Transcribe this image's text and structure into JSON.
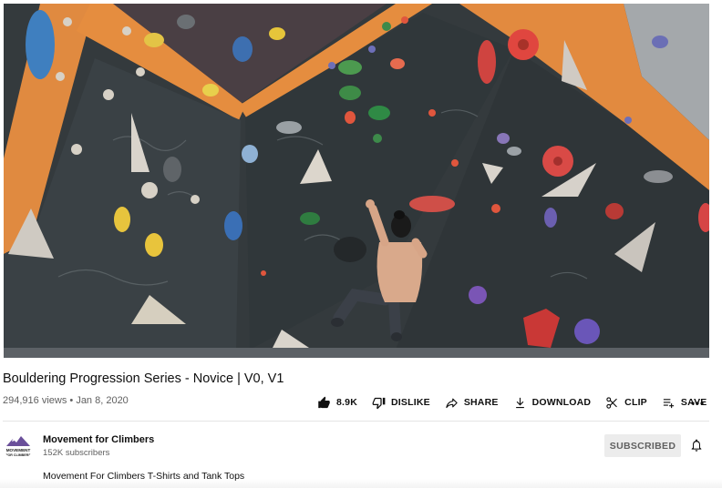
{
  "video": {
    "title": "Bouldering Progression Series - Novice | V0, V1",
    "views": "294,916 views",
    "separator": "•",
    "date": "Jan 8, 2020"
  },
  "actions": {
    "like_count": "8.9K",
    "dislike_label": "DISLIKE",
    "share_label": "SHARE",
    "download_label": "DOWNLOAD",
    "clip_label": "CLIP",
    "save_label": "SAVE"
  },
  "channel": {
    "name": "Movement for Climbers",
    "subscribers": "152K subscribers",
    "subscribe_state": "SUBSCRIBED",
    "avatar_text_top": "MOVEMENT",
    "avatar_text_bottom": "FOR CLIMBERS"
  },
  "description": {
    "first_line": "Movement For Climbers T-Shirts and Tank Tops"
  },
  "colors": {
    "wall_dark": "#343a3d",
    "wall_orange": "#e28a3f",
    "wall_grey": "#9aa0a4",
    "floor": "#5c6166",
    "subscribed_bg": "#ececec",
    "meta_text": "#606060"
  },
  "icons": {
    "like": "thumbs-up-icon",
    "dislike": "thumbs-down-icon",
    "share": "share-icon",
    "download": "download-icon",
    "clip": "scissors-icon",
    "save": "playlist-add-icon",
    "more": "more-horizontal-icon",
    "bell": "bell-icon"
  }
}
